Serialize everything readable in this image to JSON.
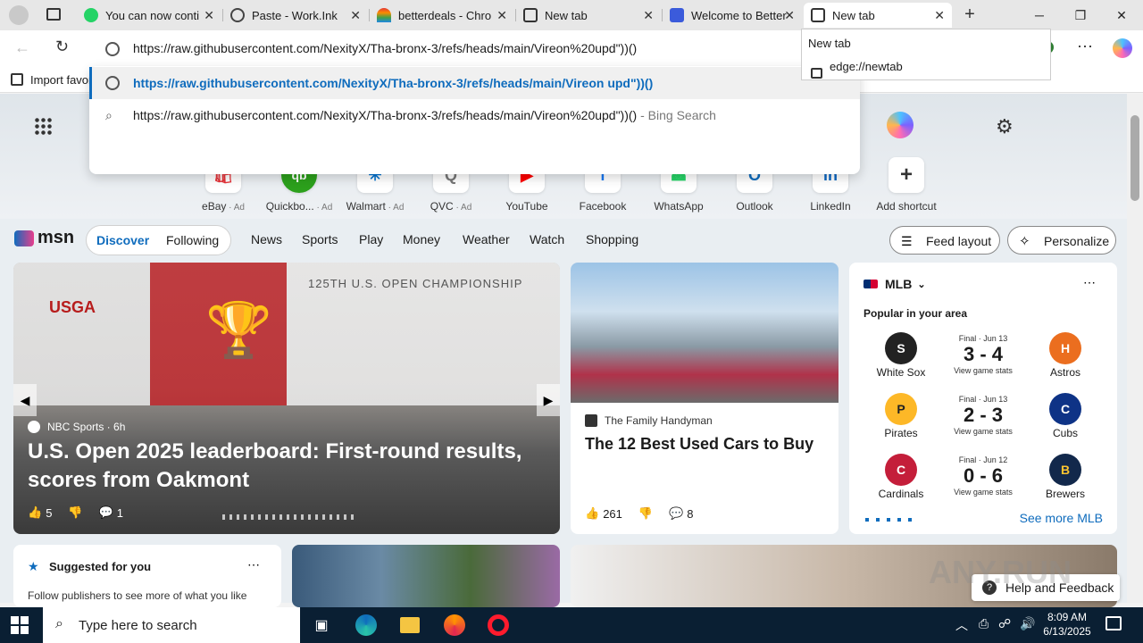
{
  "tabs": [
    {
      "label": "You can now conti",
      "icon": "whatsapp-icon",
      "color": "#25d366"
    },
    {
      "label": "Paste - Work.Ink",
      "icon": "globe-icon",
      "color": "#555"
    },
    {
      "label": "betterdeals - Chro",
      "icon": "rainbow-icon",
      "color": "#e8703a"
    },
    {
      "label": "New tab",
      "icon": "newtab-icon",
      "color": "#333"
    },
    {
      "label": "Welcome to Better",
      "icon": "betterdeals-icon",
      "color": "#3b5bdb"
    },
    {
      "label": "New tab",
      "icon": "newtab-icon",
      "color": "#333"
    }
  ],
  "address": {
    "value": "https://raw.githubusercontent.com/NexityX/Tha-bronx-3/refs/heads/main/Vireon%20upd\"))()"
  },
  "omnibox": {
    "suggestion1": "https://raw.githubusercontent.com/NexityX/Tha-bronx-3/refs/heads/main/Vireon upd\"))()",
    "suggestion2": "https://raw.githubusercontent.com/NexityX/Tha-bronx-3/refs/heads/main/Vireon%20upd\"))()",
    "suggestion2_suffix": " - Bing Search"
  },
  "tooltip": {
    "title": "New tab",
    "url": "edge://newtab"
  },
  "favorites": {
    "import_label": "Import favor"
  },
  "shortcuts": [
    {
      "label": "eBay",
      "ad": " · Ad",
      "glyph": "🛍",
      "color": "#e53238"
    },
    {
      "label": "Quickbo...",
      "ad": " · Ad",
      "glyph": "qb",
      "color": "#2ca01c"
    },
    {
      "label": "Walmart",
      "ad": " · Ad",
      "glyph": "✳",
      "color": "#0071ce"
    },
    {
      "label": "QVC",
      "ad": " · Ad",
      "glyph": "Q",
      "color": "#777"
    },
    {
      "label": "YouTube",
      "ad": "",
      "glyph": "▶",
      "color": "#ff0000"
    },
    {
      "label": "Facebook",
      "ad": "",
      "glyph": "f",
      "color": "#1877f2"
    },
    {
      "label": "WhatsApp",
      "ad": "",
      "glyph": "☎",
      "color": "#25d366"
    },
    {
      "label": "Outlook",
      "ad": "",
      "glyph": "O",
      "color": "#0f6cbd"
    },
    {
      "label": "LinkedIn",
      "ad": "",
      "glyph": "in",
      "color": "#0a66c2"
    },
    {
      "label": "Add shortcut",
      "ad": "",
      "glyph": "+",
      "color": "#333"
    }
  ],
  "msn": {
    "brand": "msn",
    "pill": [
      "Discover",
      "Following"
    ],
    "nav": [
      "News",
      "Sports",
      "Play",
      "Money",
      "Weather",
      "Watch",
      "Shopping"
    ],
    "feed_layout": "Feed layout",
    "personalize": "Personalize"
  },
  "hero_card": {
    "source": "NBC Sports · 6h",
    "title": "U.S. Open 2025 leaderboard: First-round results, scores from Oakmont",
    "likes": "5",
    "comments": "1",
    "board_text": "125TH U.S. OPEN CHAMPIONSHIP",
    "usga": "USGA"
  },
  "car_card": {
    "source": "The Family Handyman",
    "title": "The 12 Best Used Cars to Buy",
    "likes": "261",
    "comments": "8"
  },
  "mlb": {
    "title": "MLB",
    "subtitle": "Popular in your area",
    "games": [
      {
        "status": "Final · Jun 13",
        "score": "3 - 4",
        "left": "White Sox",
        "right": "Astros",
        "stats": "View game stats"
      },
      {
        "status": "Final · Jun 13",
        "score": "2 - 3",
        "left": "Pirates",
        "right": "Cubs",
        "stats": "View game stats"
      },
      {
        "status": "Final · Jun 12",
        "score": "0 - 6",
        "left": "Cardinals",
        "right": "Brewers",
        "stats": "View game stats"
      }
    ],
    "see_more": "See more MLB"
  },
  "suggested": {
    "title": "Suggested for you",
    "text": "Follow publishers to see more of what you like"
  },
  "help": "Help and Feedback",
  "watermark": "ANY.RUN",
  "taskbar": {
    "search_placeholder": "Type here to search",
    "time": "8:09 AM",
    "date": "6/13/2025"
  }
}
